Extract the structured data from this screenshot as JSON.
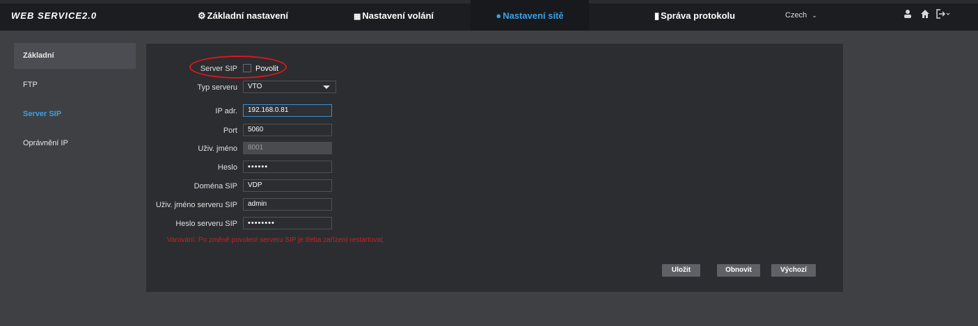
{
  "header": {
    "logo": "WEB SERVICE2.0",
    "nav": [
      {
        "label": "Základní nastavení"
      },
      {
        "label": "Nastavení volání"
      },
      {
        "label": "Nastavení sítě"
      },
      {
        "label": "Správa protokolu"
      }
    ],
    "language": "Czech",
    "language_caret": "⌄"
  },
  "sidebar": {
    "items": [
      {
        "label": "Základní"
      },
      {
        "label": "FTP"
      },
      {
        "label": "Server SIP"
      },
      {
        "label": "Oprávnění IP"
      }
    ]
  },
  "form": {
    "server_sip_label": "Server SIP",
    "enable_label": "Povolit",
    "enabled": false,
    "server_type_label": "Typ serveru",
    "server_type_value": "VTO",
    "ip_label": "IP adr.",
    "ip_value": "192.168.0.81",
    "port_label": "Port",
    "port_value": "5060",
    "username_label": "Uživ. jméno",
    "username_value": "8001",
    "password_label": "Heslo",
    "password_value": "••••••",
    "domain_label": "Doména SIP",
    "domain_value": "VDP",
    "server_username_label": "Uživ. jméno serveru SIP",
    "server_username_value": "admin",
    "server_password_label": "Heslo serveru SIP",
    "server_password_value": "••••••••",
    "warning": "Varování: Po změně povolení serveru SIP je třeba zařízení restartovat."
  },
  "buttons": {
    "save": "Uložit",
    "refresh": "Obnovit",
    "default": "Výchozí"
  },
  "colors": {
    "accent": "#3aa0e8",
    "warning": "#c0262a",
    "highlight_oval": "#e0161c"
  }
}
